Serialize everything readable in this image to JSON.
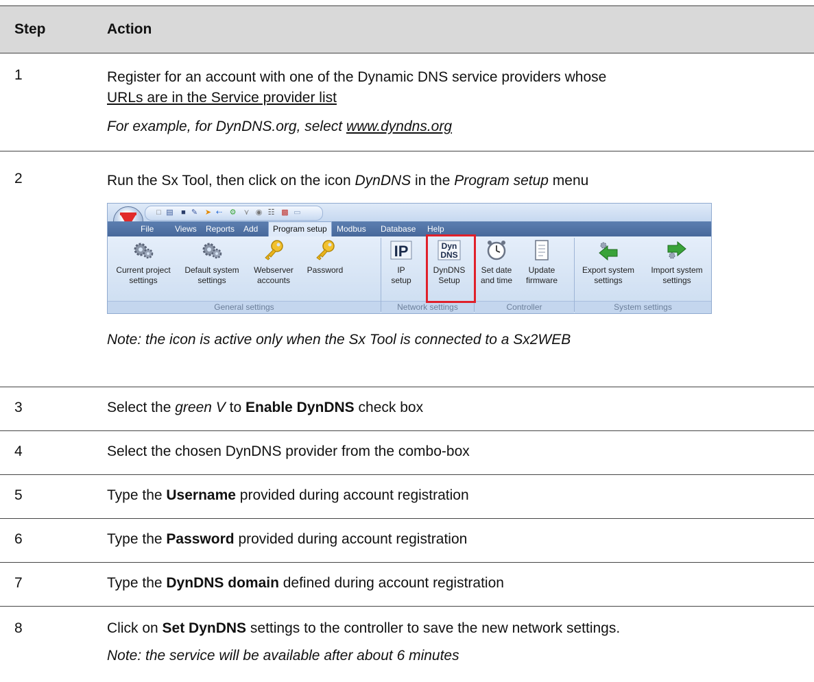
{
  "table": {
    "header": {
      "step": "Step",
      "action": "Action"
    },
    "rows": [
      {
        "num": "1",
        "line1": "Register for an account with one of the Dynamic DNS service providers whose",
        "line2_link": "URLs are in the Service provider list",
        "ex_pre": "For example, for DynDNS.org, select ",
        "ex_link": "www.dyndns.org"
      },
      {
        "num": "2",
        "t1": "Run the Sx Tool, then click on the icon ",
        "t2": "DynDNS",
        "t3": " in the ",
        "t4": "Program setup",
        "t5": " menu",
        "note": "Note: the icon is active only when the Sx Tool is connected to a Sx2WEB"
      },
      {
        "num": "3",
        "a": "Select the ",
        "b": "green V",
        "c": " to ",
        "d": "Enable DynDNS",
        "e": " check box"
      },
      {
        "num": "4",
        "a": "Select the chosen DynDNS provider from the combo-box"
      },
      {
        "num": "5",
        "a": "Type the ",
        "b": "Username",
        "c": " provided during account registration"
      },
      {
        "num": "6",
        "a": "Type the ",
        "b": "Password",
        "c": " provided during account registration"
      },
      {
        "num": "7",
        "a": "Type the ",
        "b": "DynDNS domain",
        "c": " defined during account registration"
      },
      {
        "num": "8",
        "a": "Click on ",
        "b": "Set DynDNS",
        "c": " settings to the controller to save the new network settings.",
        "note": "Note: the service will be available after about 6 minutes"
      }
    ]
  },
  "ribbon": {
    "menu": [
      "File",
      "Views",
      "Reports",
      "Add",
      "Program setup",
      "Modbus",
      "Database",
      "Help"
    ],
    "buttons": [
      {
        "l1": "Current project",
        "l2": "settings",
        "icon": "gears-icon"
      },
      {
        "l1": "Default system",
        "l2": "settings",
        "icon": "gears-icon"
      },
      {
        "l1": "Webserver",
        "l2": "accounts",
        "icon": "key-icon"
      },
      {
        "l1": "Password",
        "l2": "",
        "icon": "key-icon"
      },
      {
        "l1": "IP",
        "l2": "setup",
        "icon": "ip-icon"
      },
      {
        "l1": "DynDNS",
        "l2": "Setup",
        "icon": "dyndns-icon"
      },
      {
        "l1": "Set date",
        "l2": "and time",
        "icon": "alarm-clock-icon"
      },
      {
        "l1": "Update",
        "l2": "firmware",
        "icon": "document-icon"
      },
      {
        "l1": "Export system",
        "l2": "settings",
        "icon": "export-arrow-icon"
      },
      {
        "l1": "Import system",
        "l2": "settings",
        "icon": "import-arrow-icon"
      }
    ],
    "groups": [
      "General settings",
      "Network settings",
      "Controller",
      "System settings"
    ],
    "ip_text": "IP",
    "dyn_text": "Dyn",
    "dns_text": "DNS"
  },
  "colors": {
    "header_bg": "#d9d9d9",
    "ribbon_bg": "#d6e4f5",
    "highlight": "#e0202a",
    "menubar": "#4f71a3"
  }
}
